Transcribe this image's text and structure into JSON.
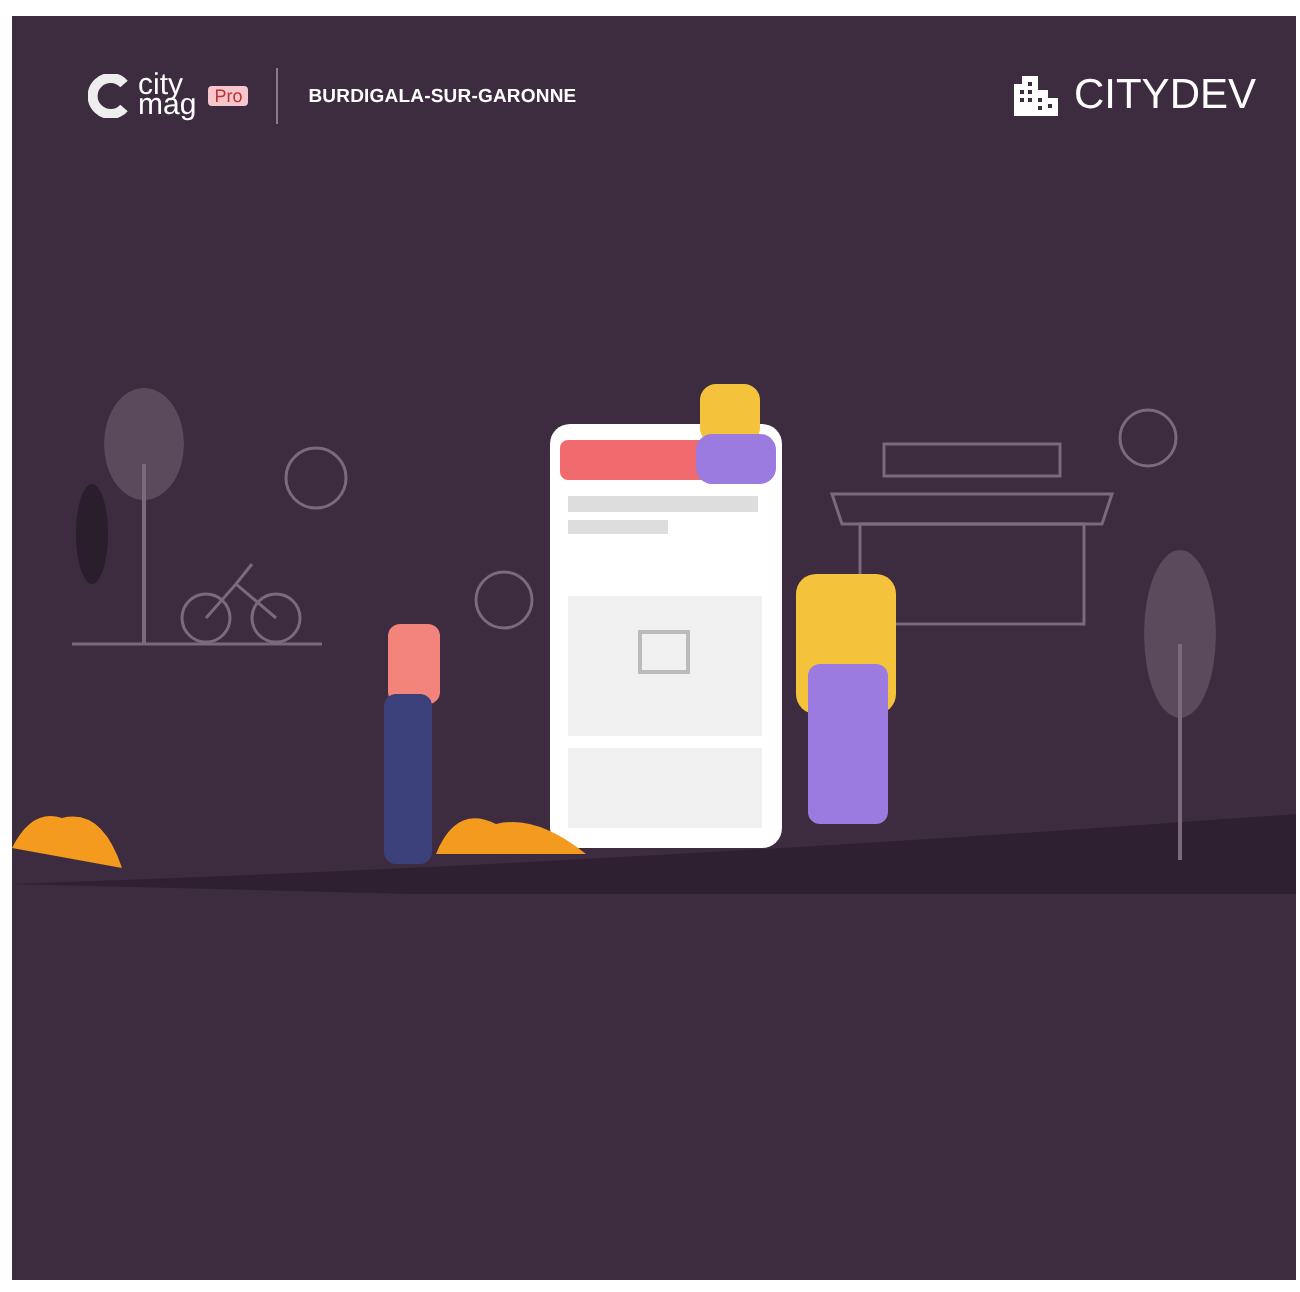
{
  "header": {
    "logo": {
      "line_1": "city",
      "line_2": "mag",
      "badge": "Pro"
    },
    "location": "BURDIGALA-SUR-GARONNE",
    "brand": "CITYDEV"
  }
}
